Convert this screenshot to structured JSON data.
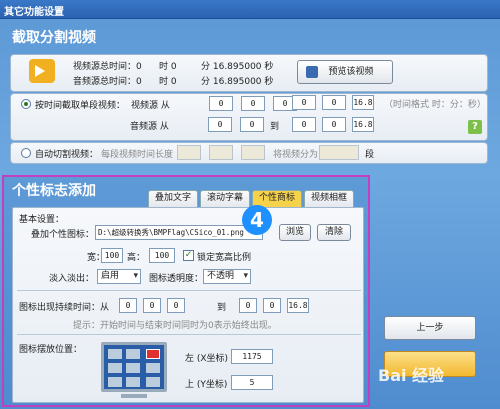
{
  "window": {
    "title": "其它功能设置"
  },
  "section1": {
    "title": "截取分割视频",
    "info": {
      "video_total_label": "视频源总时间：0",
      "video_hour_label": "时 0",
      "video_min_label": "分 16.895000 秒",
      "audio_total_label": "音频源总时间：0",
      "audio_hour_label": "时 0",
      "audio_min_label": "分 16.895000 秒",
      "preview_button": "预览该视频"
    },
    "by_time": {
      "label": "按时间截取单段视频：",
      "video_label": "视频源 从",
      "audio_label": "音频源 从",
      "to_label": "到",
      "format_hint": "（时间格式 时：分：秒）",
      "video_from": [
        "0",
        "0",
        "0"
      ],
      "video_to": [
        "0",
        "0",
        "16.8"
      ],
      "audio_from": [
        "0",
        "0",
        "0"
      ],
      "audio_to": [
        "0",
        "0",
        "16.8"
      ]
    },
    "auto_split": {
      "label": "自动切割视频：",
      "length_label": "每段视频时间长度",
      "split_label": "将视频分为",
      "segment_unit": "段"
    }
  },
  "section2": {
    "title": "个性标志添加",
    "tabs": [
      "叠加文字",
      "滚动字幕",
      "个性商标",
      "视频相框"
    ],
    "active_tab": 2,
    "basic_label": "基本设置：",
    "overlay_label": "叠加个性图标：",
    "overlay_path": "D:\\超级转换秀\\BMPFlag\\CSico_01.png",
    "browse_button": "浏览",
    "clear_button": "清除",
    "width_label": "宽：",
    "width_value": "100",
    "height_label": "高：",
    "height_value": "100",
    "lock_ratio_label": "锁定宽高比例",
    "fade_label": "淡入淡出：",
    "fade_value": "启用",
    "opacity_label": "图标透明度：",
    "opacity_value": "不透明",
    "duration_label": "图标出现持续时间：从",
    "duration_to_label": "到",
    "duration_from": [
      "0",
      "0",
      "0"
    ],
    "duration_to": [
      "0",
      "0",
      "16.8"
    ],
    "duration_hint": "提示：开始时间与结束时间同时为0表示始终出现。",
    "position_label": "图标摆放位置：",
    "left_label": "左 (X坐标)",
    "left_value": "1175",
    "top_label": "上 (Y坐标)",
    "top_value": "5"
  },
  "buttons": {
    "prev": "上一步"
  },
  "overlays": {
    "step_badge": "4",
    "watermark": "Bai 经验"
  },
  "colors": {
    "title_bar": "#2a62b0",
    "window_bg": "#6ea8e0",
    "highlight_border": "#c040c0",
    "active_tab": "#f5d24a",
    "badge": "#1e90ff"
  }
}
